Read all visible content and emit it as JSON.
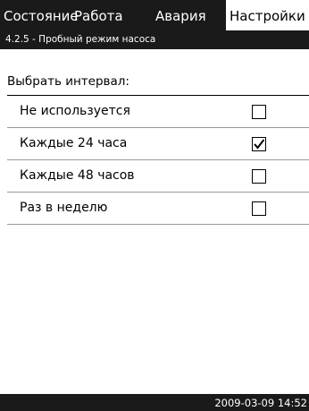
{
  "tabs": [
    {
      "label": "Состояние",
      "active": false
    },
    {
      "label": "Работа",
      "active": false
    },
    {
      "label": "Авария",
      "active": false
    },
    {
      "label": "Настройки",
      "active": true
    }
  ],
  "breadcrumb": "4.2.5 - Пробный режим насоса",
  "prompt": "Выбрать интервал:",
  "options": [
    {
      "label": "Не используется",
      "checked": false
    },
    {
      "label": "Каждые 24 часа",
      "checked": true
    },
    {
      "label": "Каждые 48 часов",
      "checked": false
    },
    {
      "label": "Раз в неделю",
      "checked": false
    }
  ],
  "footer": {
    "datetime": "2009-03-09 14:52"
  },
  "colors": {
    "bar": "#1a1a1a",
    "background": "#ffffff"
  }
}
